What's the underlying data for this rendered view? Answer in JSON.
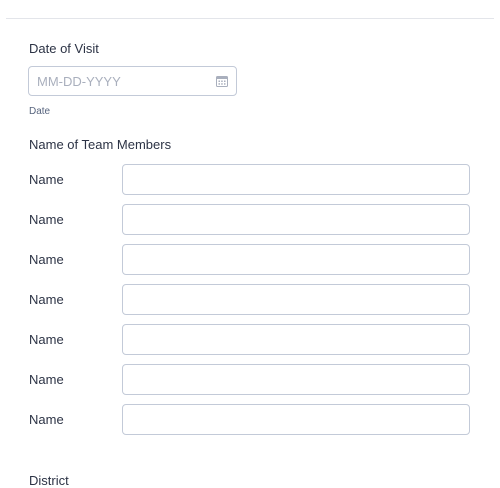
{
  "date_of_visit": {
    "label": "Date of Visit",
    "placeholder": "MM-DD-YYYY",
    "value": "",
    "sublabel": "Date",
    "icon": "calendar-icon"
  },
  "team_members": {
    "label": "Name of Team Members",
    "rows": [
      {
        "label": "Name",
        "value": ""
      },
      {
        "label": "Name",
        "value": ""
      },
      {
        "label": "Name",
        "value": ""
      },
      {
        "label": "Name",
        "value": ""
      },
      {
        "label": "Name",
        "value": ""
      },
      {
        "label": "Name",
        "value": ""
      },
      {
        "label": "Name",
        "value": ""
      }
    ]
  },
  "district": {
    "label": "District"
  },
  "colors": {
    "text": "#2c3345",
    "border": "#c3cad8",
    "placeholder": "#a9afbd"
  }
}
